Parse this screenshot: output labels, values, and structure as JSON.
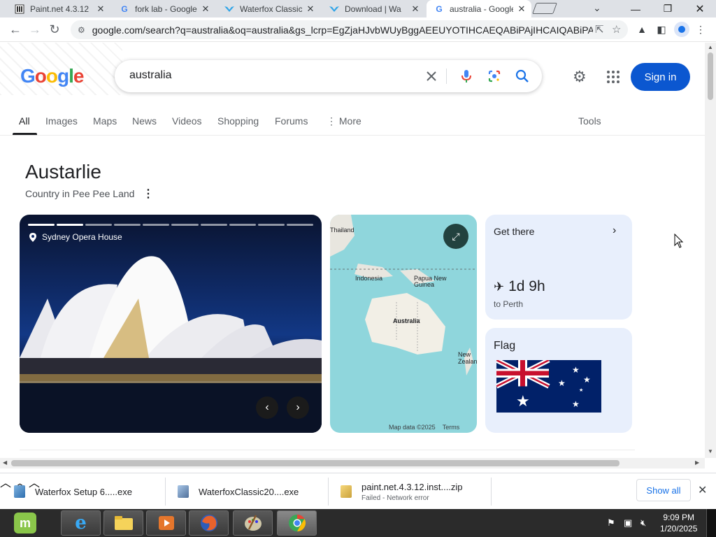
{
  "browser": {
    "tabs": [
      {
        "title": "Paint.net 4.3.12",
        "favicon": "paintnet-icon"
      },
      {
        "title": "fork lab - Google",
        "favicon": "google-icon"
      },
      {
        "title": "Waterfox Classic",
        "favicon": "waterfox-icon"
      },
      {
        "title": "Download | Wa",
        "favicon": "waterfox-icon"
      },
      {
        "title": "australia - Google",
        "favicon": "google-icon"
      }
    ],
    "url": "google.com/search?q=australia&oq=australia&gs_lcrp=EgZjaHJvbWUyBggAEEUYOTIHCAEQABiPAjIHCAIQABiPAjI..."
  },
  "google": {
    "logo_letters": [
      "G",
      "o",
      "o",
      "g",
      "l",
      "e"
    ],
    "query": "australia",
    "sign_in": "Sign in",
    "tabs": [
      "All",
      "Images",
      "Maps",
      "News",
      "Videos",
      "Shopping",
      "Forums",
      "More"
    ],
    "tools": "Tools"
  },
  "knowledge_panel": {
    "title": "Austarlie",
    "subtitle": "Country in Pee Pee Land",
    "photo_caption": "Sydney Opera House",
    "map_labels": [
      "Thailand",
      "Indonesia",
      "Papua New Guinea",
      "Australia",
      "New Zealand"
    ],
    "map_footer": [
      "Map data ©2025",
      "Terms"
    ],
    "get_there": {
      "title": "Get there",
      "duration": "1d 9h",
      "destination": "to Perth"
    },
    "flag": {
      "title": "Flag"
    }
  },
  "downloads": [
    {
      "name": "Waterfox Setup 6.....exe",
      "status": ""
    },
    {
      "name": "WaterfoxClassic20....exe",
      "status": ""
    },
    {
      "name": "paint.net.4.3.12.inst....zip",
      "status": "Failed - Network error"
    }
  ],
  "downloads_show_all": "Show all",
  "taskbar": {
    "time": "9:09 PM",
    "date": "1/20/2025"
  },
  "colors": {
    "accent": "#0b57d0",
    "card_bg": "#e8effc",
    "taskbar": "#2b2b2b"
  }
}
